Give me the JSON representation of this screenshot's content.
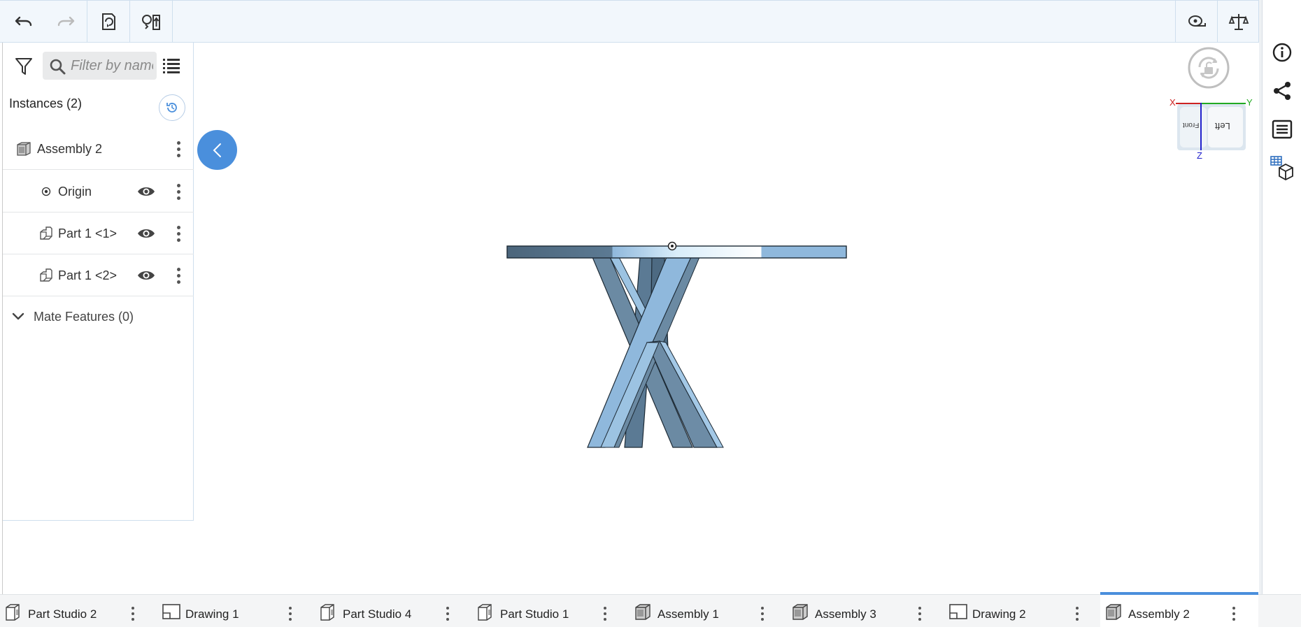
{
  "toolbar": {
    "undo_icon": "undo-icon",
    "redo_icon": "redo-icon",
    "insert_icon": "insert-part-icon",
    "replace_icon": "replace-part-icon",
    "measure_icon": "measure-tape-icon",
    "mass_icon": "mass-properties-icon"
  },
  "panel": {
    "filter_placeholder": "Filter by name",
    "instances_label": "Instances (2)",
    "items": [
      {
        "label": "Assembly 2",
        "icon": "assembly-icon"
      },
      {
        "label": "Origin",
        "icon": "origin-icon"
      },
      {
        "label": "Part 1 <1>",
        "icon": "part-icon"
      },
      {
        "label": "Part 1 <2>",
        "icon": "part-icon"
      }
    ],
    "mate_features_label": "Mate Features (0)"
  },
  "viewcube": {
    "axis_x": "X",
    "axis_y": "Y",
    "axis_z": "Z",
    "face_front": "Front",
    "face_left": "Left"
  },
  "tabs": [
    {
      "label": "Part Studio 2",
      "icon": "part-studio-icon",
      "active": false
    },
    {
      "label": "Drawing 1",
      "icon": "drawing-icon",
      "active": false
    },
    {
      "label": "Part Studio 4",
      "icon": "part-studio-icon",
      "active": false
    },
    {
      "label": "Part Studio 1",
      "icon": "part-studio-icon",
      "active": false
    },
    {
      "label": "Assembly 1",
      "icon": "assembly-icon",
      "active": false
    },
    {
      "label": "Assembly 3",
      "icon": "assembly-icon",
      "active": false
    },
    {
      "label": "Drawing 2",
      "icon": "drawing-icon",
      "active": false
    },
    {
      "label": "Assembly 2",
      "icon": "assembly-icon",
      "active": true
    }
  ],
  "colors": {
    "accent": "#4a8fdc",
    "toolbar_bg": "#f2f7fc",
    "model_dark": "#5b7a94",
    "model_light": "#8fb8dc",
    "axis_x": "#cc2222",
    "axis_y": "#22aa22",
    "axis_z": "#2222cc"
  }
}
